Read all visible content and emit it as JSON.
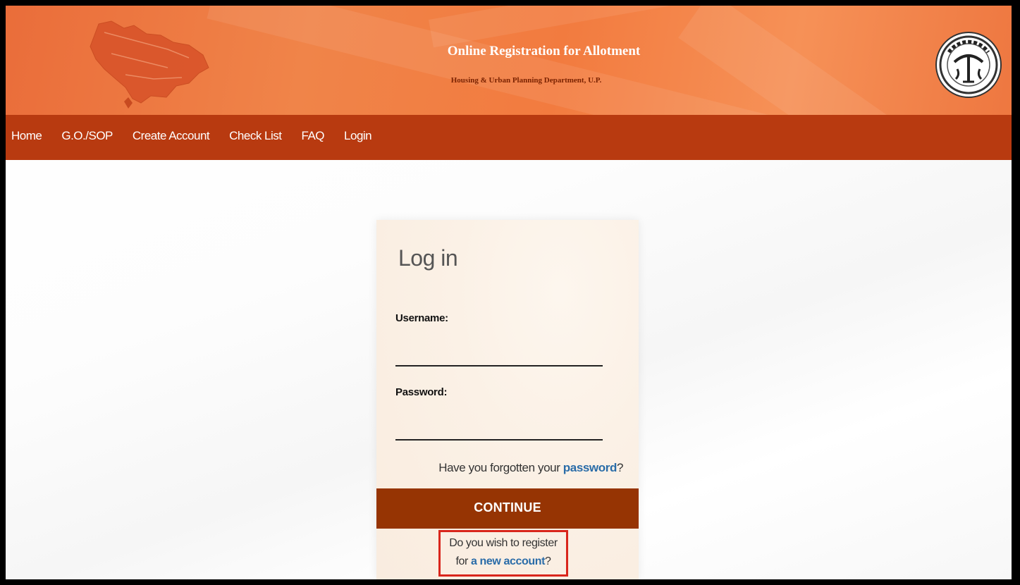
{
  "header": {
    "title": "Online Registration for Allotment",
    "subtitle": "Housing & Urban Planning Department, U.P."
  },
  "nav": {
    "items": [
      {
        "label": "Home"
      },
      {
        "label": "G.O./SOP"
      },
      {
        "label": "Create Account"
      },
      {
        "label": "Check List"
      },
      {
        "label": "FAQ"
      },
      {
        "label": "Login"
      }
    ]
  },
  "login": {
    "heading": "Log in",
    "username_label": "Username:",
    "username_value": "",
    "password_label": "Password:",
    "password_value": "",
    "forgot_prefix": "Have you forgotten your ",
    "forgot_link": "password",
    "forgot_suffix": "?",
    "continue_label": "CONTINUE",
    "register_line1": "Do you wish to register",
    "register_prefix": "for ",
    "register_link": "a new account",
    "register_suffix": "?"
  },
  "colors": {
    "banner": "#f08449",
    "navbar": "#b83a10",
    "continue_button": "#963403",
    "link": "#2a6ca8",
    "highlight_border": "#d9261c"
  }
}
